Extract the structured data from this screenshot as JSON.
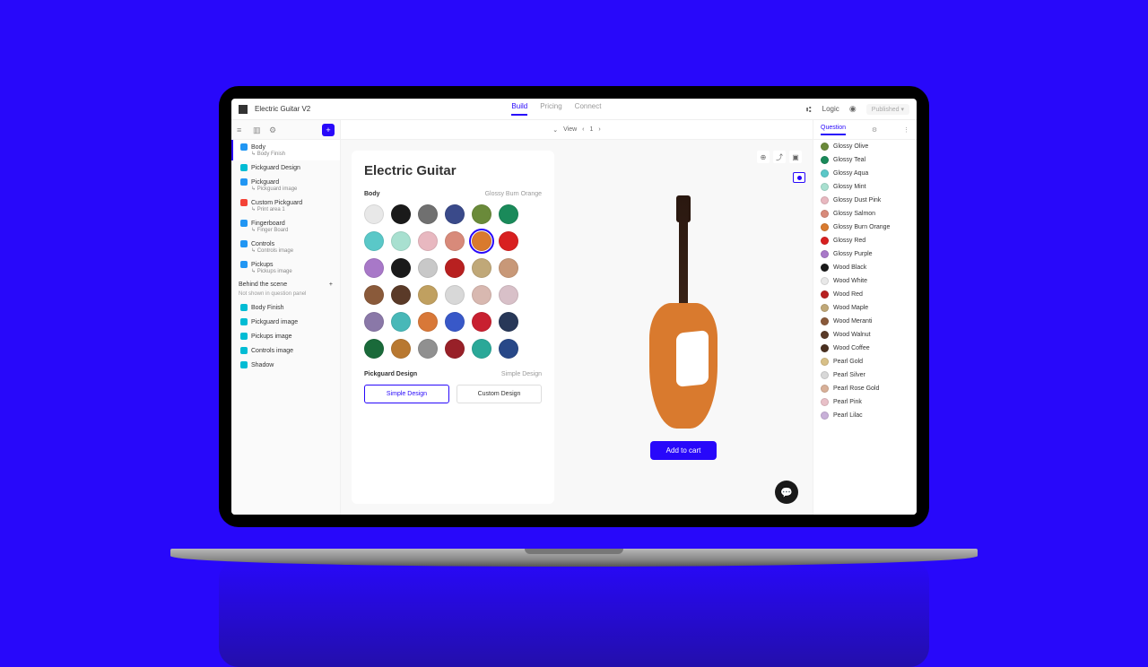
{
  "project": "Electric Guitar V2",
  "top_tabs": {
    "build": "Build",
    "pricing": "Pricing",
    "connect": "Connect"
  },
  "logic": "Logic",
  "published": "Published",
  "viewbar": {
    "label": "View",
    "count": "1"
  },
  "sidebar_groups": [
    {
      "icon": "ico-blue",
      "title": "Body",
      "sub": "Body Finish",
      "sel": true
    },
    {
      "icon": "ico-cyan",
      "title": "Pickguard Design",
      "sub": ""
    },
    {
      "icon": "ico-blue",
      "title": "Pickguard",
      "sub": "Pickguard image"
    },
    {
      "icon": "ico-red",
      "title": "Custom Pickguard",
      "sub": "Print area 1"
    },
    {
      "icon": "ico-blue",
      "title": "Fingerboard",
      "sub": "Finger Board"
    },
    {
      "icon": "ico-blue",
      "title": "Controls",
      "sub": "Controls image"
    },
    {
      "icon": "ico-blue",
      "title": "Pickups",
      "sub": "Pickups image"
    }
  ],
  "behind_label": "Behind the scene",
  "behind_hint": "Not shown in question panel",
  "behind_items": [
    "Body Finish",
    "Pickguard image",
    "Pickups image",
    "Controls image",
    "Shadow"
  ],
  "product_title": "Electric Guitar",
  "body_opt": {
    "label": "Body",
    "value": "Glossy Burn Orange"
  },
  "swatches": [
    {
      "c": "#e8e8e8"
    },
    {
      "c": "#1a1a1a"
    },
    {
      "c": "#707070"
    },
    {
      "c": "#3a4a8a"
    },
    {
      "c": "#6a8a3a"
    },
    {
      "c": "#1a8a5a"
    },
    {
      "c": "#5ac8c8"
    },
    {
      "c": "#a8e0d0"
    },
    {
      "c": "#e8b8c0"
    },
    {
      "c": "#d88a7a"
    },
    {
      "c": "#d97a2e",
      "sel": true
    },
    {
      "c": "#d82020"
    },
    {
      "c": "#a878c8"
    },
    {
      "c": "#1a1a1a"
    },
    {
      "c": "#c8c8c8"
    },
    {
      "c": "#b82020"
    },
    {
      "c": "#c0a878"
    },
    {
      "c": "#c89878"
    },
    {
      "c": "#8a5a3a"
    },
    {
      "c": "#5a3a28"
    },
    {
      "c": "#c0a060"
    },
    {
      "c": "#d8d8d8"
    },
    {
      "c": "#d8b8b0"
    },
    {
      "c": "#d8c0c8"
    },
    {
      "c": "#8a78a8"
    },
    {
      "c": "#48b8b8"
    },
    {
      "c": "#d87838"
    },
    {
      "c": "#3858c8"
    },
    {
      "c": "#c82030"
    },
    {
      "c": "#283858"
    },
    {
      "c": "#1a6a3a"
    },
    {
      "c": "#b87830"
    },
    {
      "c": "#909090"
    },
    {
      "c": "#982028"
    },
    {
      "c": "#2aa898"
    },
    {
      "c": "#284888"
    }
  ],
  "pickguard_opt": {
    "label": "Pickguard Design",
    "value": "Simple Design"
  },
  "pickguard_buttons": {
    "simple": "Simple Design",
    "custom": "Custom Design"
  },
  "cart": "Add to cart",
  "right_tab": "Question",
  "right_options": [
    {
      "c": "#6a8a3a",
      "l": "Glossy Olive"
    },
    {
      "c": "#1a8a5a",
      "l": "Glossy Teal"
    },
    {
      "c": "#5ac8c8",
      "l": "Glossy Aqua"
    },
    {
      "c": "#a8e0d0",
      "l": "Glossy Mint"
    },
    {
      "c": "#e8b8c0",
      "l": "Glossy Dust Pink"
    },
    {
      "c": "#d88a7a",
      "l": "Glossy Salmon"
    },
    {
      "c": "#d97a2e",
      "l": "Glossy Burn Orange"
    },
    {
      "c": "#d82020",
      "l": "Glossy Red"
    },
    {
      "c": "#a878c8",
      "l": "Glossy Purple"
    },
    {
      "c": "#1a1a1a",
      "l": "Wood Black"
    },
    {
      "c": "#e8e8e8",
      "l": "Wood White"
    },
    {
      "c": "#b82020",
      "l": "Wood Red"
    },
    {
      "c": "#c0a878",
      "l": "Wood Maple"
    },
    {
      "c": "#8a5a3a",
      "l": "Wood Meranti"
    },
    {
      "c": "#5a3a28",
      "l": "Wood Walnut"
    },
    {
      "c": "#4a3020",
      "l": "Wood Coffee"
    },
    {
      "c": "#d8c088",
      "l": "Pearl Gold"
    },
    {
      "c": "#d8d8d8",
      "l": "Pearl Silver"
    },
    {
      "c": "#d8b098",
      "l": "Pearl Rose Gold"
    },
    {
      "c": "#e8c0c8",
      "l": "Pearl Pink"
    },
    {
      "c": "#c8b0d8",
      "l": "Pearl Lilac"
    }
  ]
}
